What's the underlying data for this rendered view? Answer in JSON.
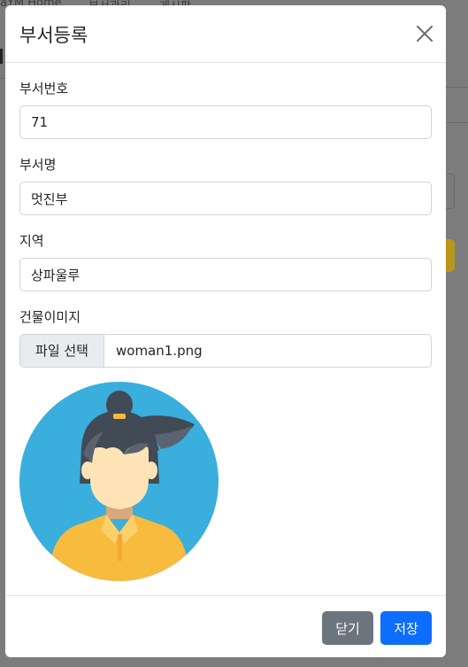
{
  "background": {
    "nav_items": [
      "aYM Home",
      "부서관리",
      "게시판"
    ]
  },
  "modal": {
    "title": "부서등록",
    "fields": [
      {
        "label": "부서번호",
        "value": "71"
      },
      {
        "label": "부서명",
        "value": "멋진부"
      },
      {
        "label": "지역",
        "value": "상파울루"
      }
    ],
    "file": {
      "label": "건물이미지",
      "button_label": "파일 선택",
      "file_name": "woman1.png"
    },
    "footer": {
      "close_label": "닫기",
      "save_label": "저장"
    }
  },
  "colors": {
    "primary": "#0d6efd",
    "secondary": "#6c757d",
    "avatar_bg": "#3aaedc",
    "shirt": "#f7bb3e"
  },
  "icons": {
    "close": "close-icon"
  }
}
